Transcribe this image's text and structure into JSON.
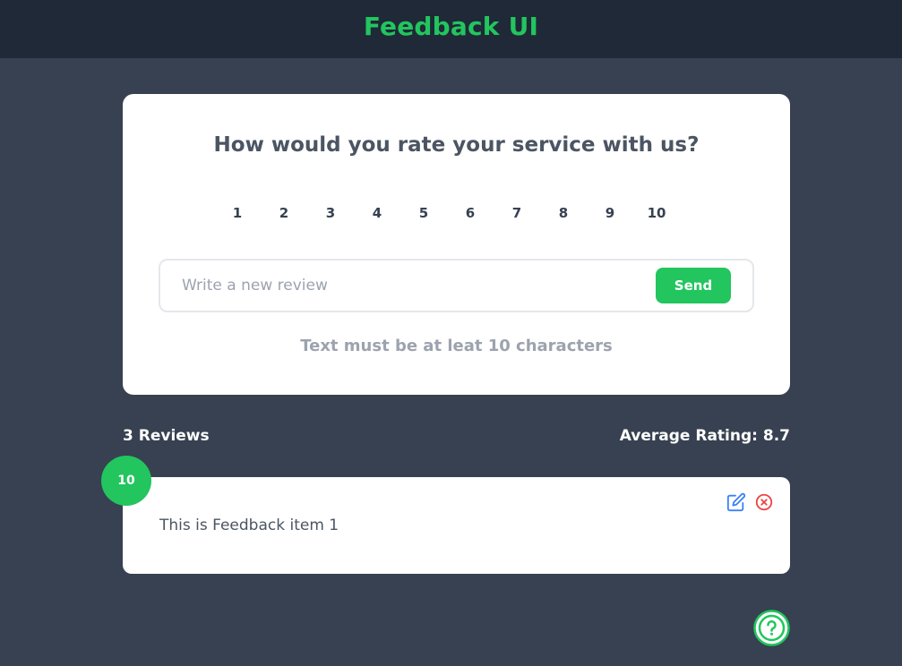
{
  "header": {
    "title": "Feedback UI"
  },
  "form": {
    "question": "How would you rate your service with us?",
    "ratings": [
      "1",
      "2",
      "3",
      "4",
      "5",
      "6",
      "7",
      "8",
      "9",
      "10"
    ],
    "input_placeholder": "Write a new review",
    "input_value": "",
    "send_label": "Send",
    "validation_message": "Text must be at leat 10 characters"
  },
  "stats": {
    "review_count": "3 Reviews",
    "average_rating": "Average Rating: 8.7"
  },
  "feedback_items": [
    {
      "rating": "10",
      "text": "This is Feedback item 1"
    }
  ],
  "icons": {
    "edit": "edit-icon",
    "delete": "close-circle-icon",
    "help": "question-circle-icon"
  },
  "colors": {
    "accent": "#22c55e",
    "header_bg": "#1f2937",
    "page_bg": "#374151",
    "card_bg": "#ffffff",
    "edit_icon": "#3b82f6",
    "delete_icon": "#ef4444"
  }
}
